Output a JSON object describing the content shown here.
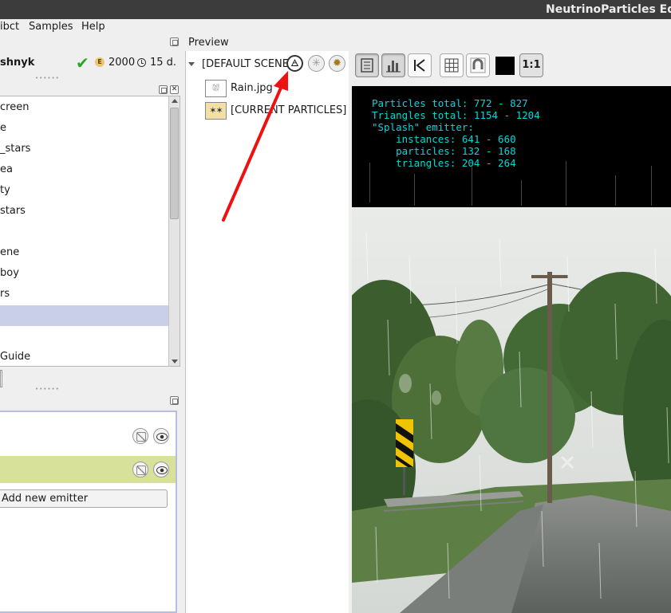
{
  "window": {
    "title": "NeutrinoParticles Edit"
  },
  "menu": {
    "items": [
      "ibct",
      "Samples",
      "Help"
    ]
  },
  "user": {
    "name": "shnyk",
    "badge": "E",
    "credits": "2000",
    "days": "15 d."
  },
  "effects": {
    "items": [
      "creen",
      "e",
      "_stars",
      "ea",
      "ty",
      "stars",
      "",
      "ene",
      "boy",
      "rs",
      "",
      "",
      "Guide"
    ],
    "selected_index": 10
  },
  "emitters": {
    "add_button": "Add new emitter"
  },
  "scene": {
    "panel_title": "Preview",
    "root": "[DEFAULT SCENE]",
    "children": [
      {
        "label": "Rain.jpg",
        "icon": "image-icon"
      },
      {
        "label": "[CURRENT PARTICLES]",
        "icon": "particles-icon"
      }
    ]
  },
  "preview": {
    "zoom_label": "1:1",
    "background_color": "#000000",
    "stats_lines": [
      "Particles total: 772 - 827",
      "Triangles total: 1154 - 1204",
      "\"Splash\" emitter:",
      "    instances: 641 - 660",
      "    particles: 132 - 168",
      "    triangles: 204 - 264"
    ]
  },
  "colors": {
    "stats_text": "#00d8d8",
    "selection": "#c9cfe8",
    "emitter_highlight": "#d7e19a",
    "annotation_arrow": "#ee1111"
  }
}
